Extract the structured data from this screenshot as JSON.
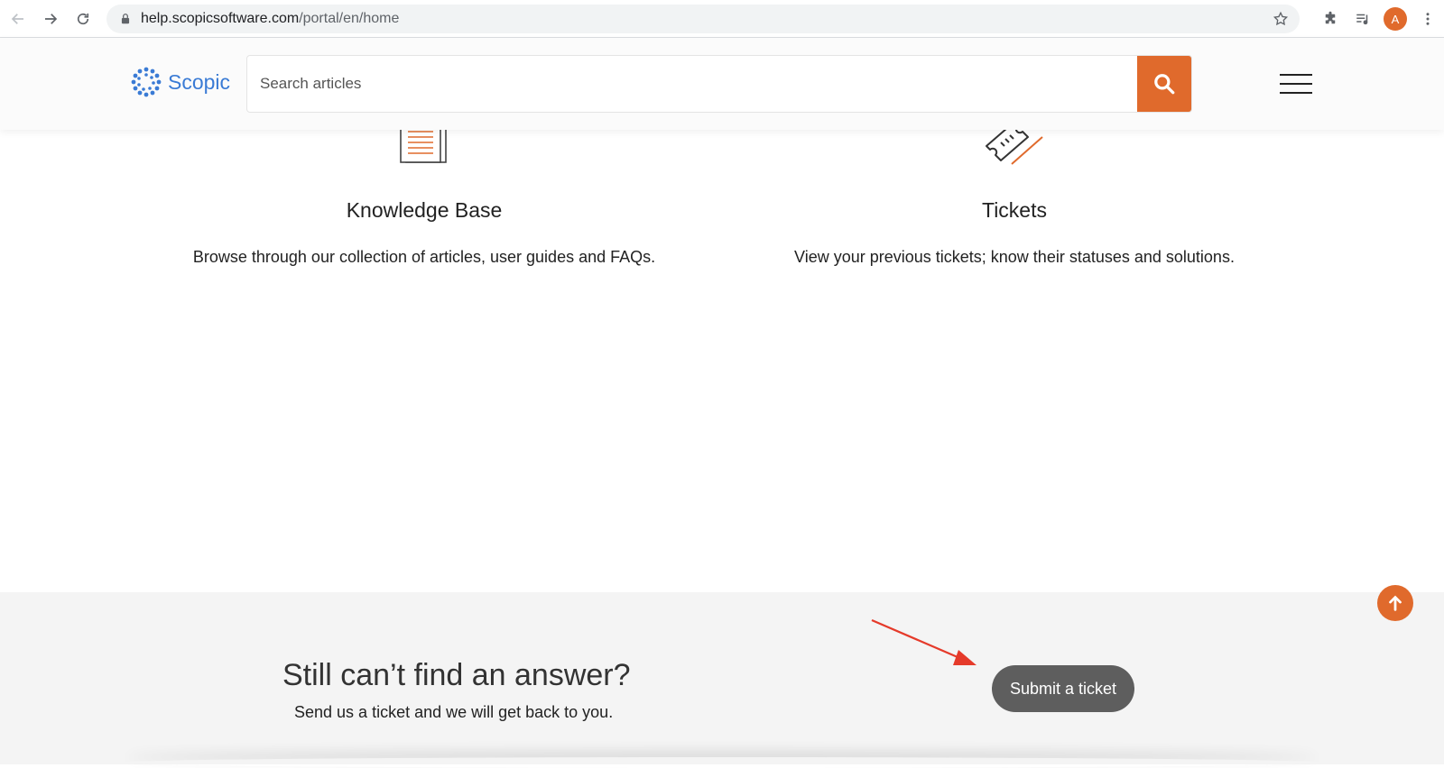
{
  "browser": {
    "url_host": "help.scopicsoftware.com",
    "url_path": "/portal/en/home",
    "avatar_letter": "A"
  },
  "header": {
    "logo_text": "Scopic",
    "search_placeholder": "Search articles"
  },
  "cards": [
    {
      "title": "Knowledge Base",
      "description": "Browse through our collection of articles, user guides and FAQs."
    },
    {
      "title": "Tickets",
      "description": "View your previous tickets; know their statuses and solutions."
    }
  ],
  "cta": {
    "heading": "Still can’t find an answer?",
    "subtext": "Send us a ticket and we will get back to you.",
    "button_label": "Submit a ticket"
  },
  "colors": {
    "accent": "#e06a2c",
    "brand_blue": "#3a7bd5",
    "button_gray": "#5e5e5e",
    "annotation_red": "#e53a2a"
  }
}
